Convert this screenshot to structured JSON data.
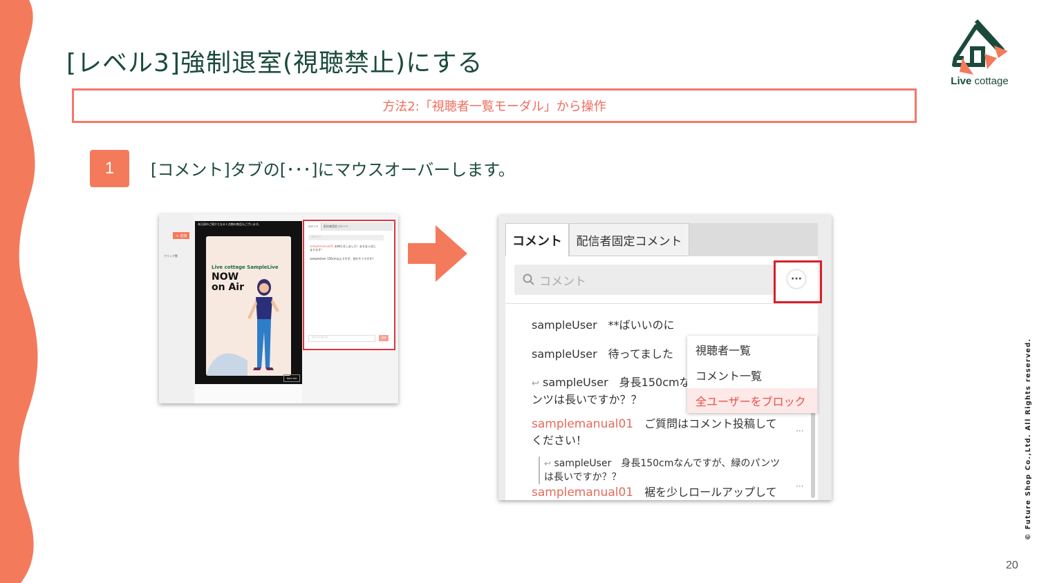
{
  "slide": {
    "title": "[レベル3]強制退室(視聴禁止)にする",
    "method": "方法2:「視聴者一覧モーダル」から操作",
    "step_number": "1",
    "step_text": "[コメント]タブの[･･･]にマウスオーバーします。",
    "page_number": "20",
    "copyright": "© Future Shop Co.,Ltd. All Rights reserved.",
    "accent_color": "#f47a5c",
    "text_color": "#1b4a3c"
  },
  "logo": {
    "brand_bold": "Live",
    "brand_rest": " cottage"
  },
  "thumbnail": {
    "add_button": "＋ 追加",
    "click_label": "クリック数",
    "video_notice": "本日初のご紹介となる１点物の商品もございます。",
    "sample_title": "Live cottage SampleLive",
    "now_line1": "NOW",
    "now_line2": "on Air",
    "item_button": "Item list",
    "tab_comment": "コメント",
    "tab_pinned": "配信者固定コメント",
    "search_placeholder": "コメント",
    "msg1_user": "samplemanual01",
    "msg1_text": "お待たせしました！まもなくはじまります！",
    "msg2_user": "sampleUser",
    "msg2_text": "150cmなんですが、合わそうですか？",
    "input_placeholder": "コメントを入力",
    "send_button": "送信"
  },
  "zoom": {
    "tab_comment": "コメント",
    "tab_pinned": "配信者固定コメント",
    "search_placeholder": "コメント",
    "more_button": "···",
    "menu": [
      "視聴者一覧",
      "コメント一覧",
      "全ユーザーをブロック"
    ],
    "messages": [
      {
        "user": "sampleUser",
        "text": "**ばいいのに"
      },
      {
        "user": "sampleUser",
        "text": "待ってました"
      },
      {
        "user": "sampleUser",
        "text": "身長150cmなんですが、緑のパ",
        "text2": "ンツは長いですか？？"
      },
      {
        "user": "samplemanual01",
        "text": "ご質問はコメント投稿して",
        "text2": "ください！"
      },
      {
        "user": "sampleUser",
        "text": "身長150cmなんですが、緑のパンツ",
        "text2": "は長いですか？？"
      },
      {
        "user": "samplemanual01",
        "text": "裾を少しロールアップして"
      }
    ]
  }
}
